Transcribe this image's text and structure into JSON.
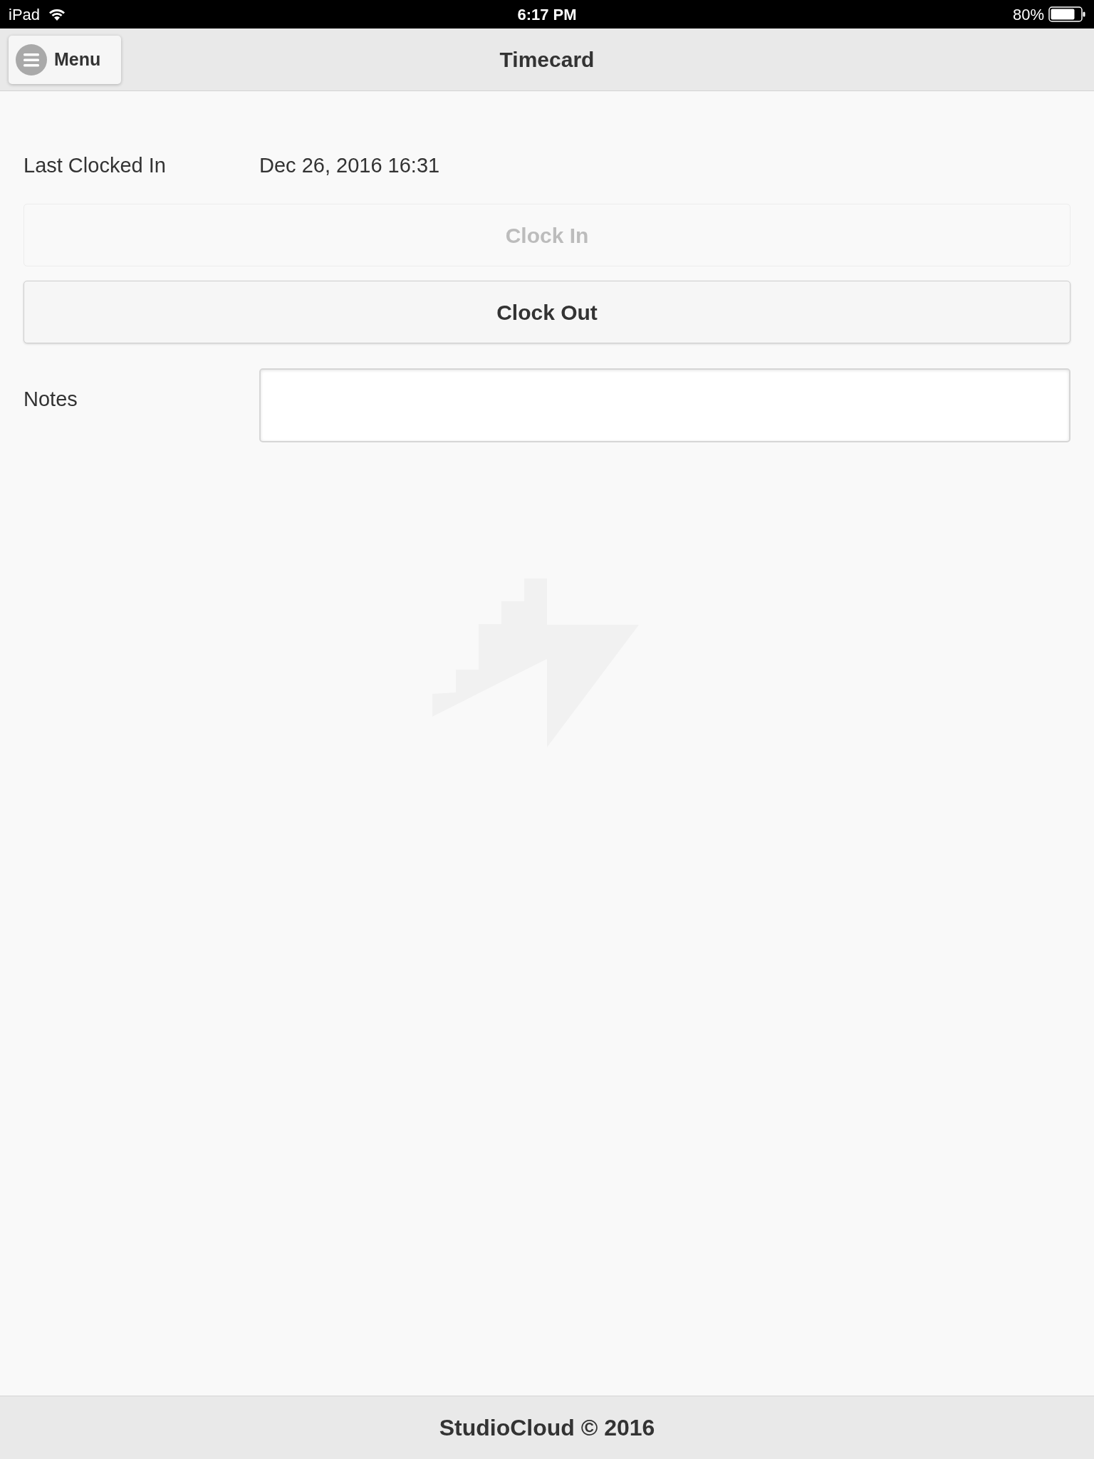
{
  "status_bar": {
    "device": "iPad",
    "time": "6:17 PM",
    "battery": "80%"
  },
  "header": {
    "menu_button": "Menu",
    "title": "Timecard"
  },
  "last_clocked_in": {
    "label": "Last Clocked In",
    "value": "Dec 26, 2016 16:31"
  },
  "buttons": [
    {
      "label": "Clock In",
      "disabled": true
    },
    {
      "label": "Clock Out",
      "disabled": false
    }
  ],
  "notes": {
    "label": "Notes"
  },
  "footer": {
    "text": "StudioCloud © 2016"
  }
}
